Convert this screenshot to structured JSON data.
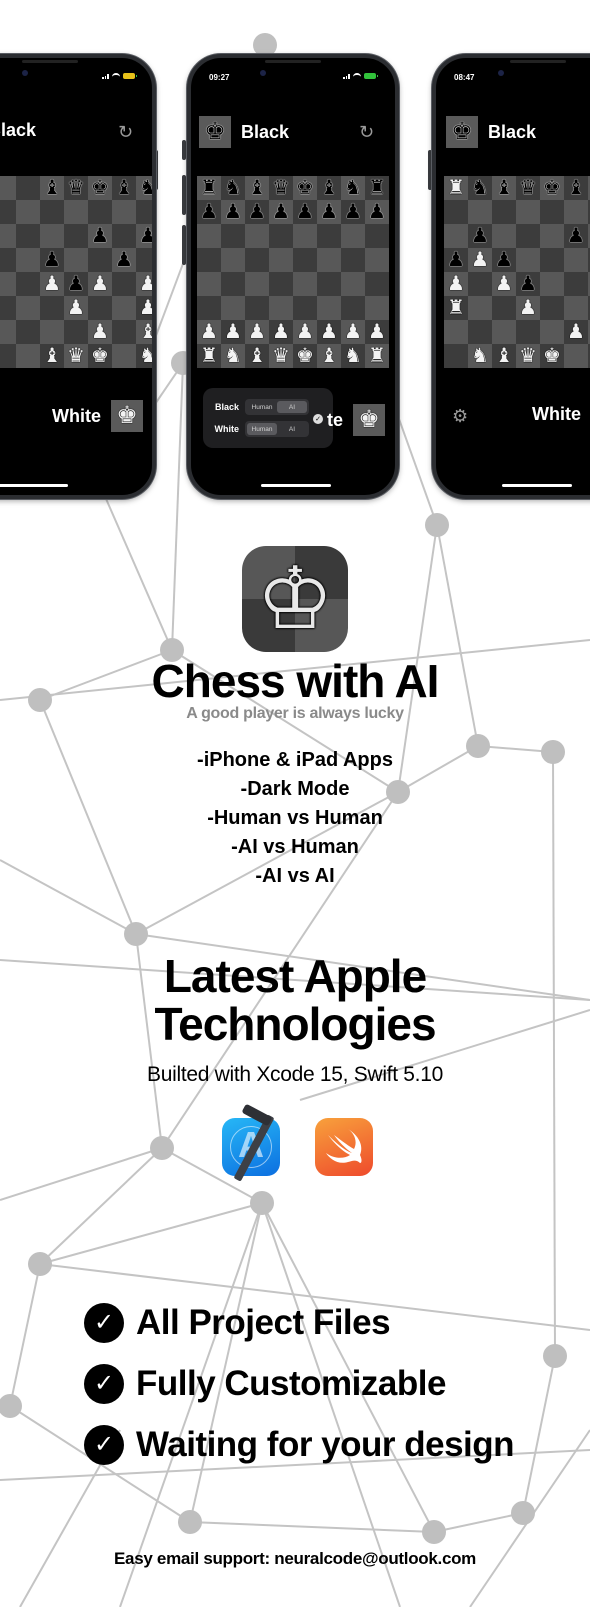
{
  "colors": {
    "background": "#ffffff",
    "network_line": "#c4c4c4",
    "network_node": "#bfbfbf",
    "phone_bezel": "#2b2d31",
    "board_light": "#585858",
    "board_dark": "#3c3c3c",
    "subtitle_gray": "#8a8a8a",
    "battery_green": "#32c23b"
  },
  "phones": [
    {
      "time": "",
      "top_player": "Black",
      "bottom_player": "White",
      "refresh_icon": "refresh-icon",
      "board": [
        "♝♛♚♝♞♜",
        "      ",
        "  p p ",
        "p  p p",
        "PpP P P",
        " P  P ",
        "  P B ",
        "BQK NR"
      ]
    },
    {
      "time": "09:27",
      "top_player": "Black",
      "bottom_player_partial": "te",
      "refresh_icon": "refresh-icon",
      "mode_panel": {
        "rows": [
          {
            "label": "Black",
            "options": [
              "Human",
              "AI"
            ],
            "selected": "AI"
          },
          {
            "label": "White",
            "options": [
              "Human",
              "AI"
            ],
            "selected": "Human"
          }
        ]
      }
    },
    {
      "time": "08:47",
      "top_player": "Black",
      "bottom_player": "White",
      "settings_icon": "gear-icon"
    }
  ],
  "promo": {
    "app_icon": "white-king-icon",
    "title": "Chess with AI",
    "tagline": "A good player is always lucky",
    "features": [
      "-iPhone & iPad  Apps",
      "-Dark Mode",
      "-Human vs Human",
      "-AI vs Human",
      "-AI vs AI"
    ],
    "tech_heading_line1": "Latest Apple",
    "tech_heading_line2": "Technologies",
    "built_with": "Builted with Xcode 15, Swift 5.10",
    "tech_icons": [
      "xcode-icon",
      "swift-icon"
    ],
    "checklist": [
      "All Project Files",
      "Fully Customizable",
      "Waiting for your design"
    ],
    "support": "Easy email support: neuralcode@outlook.com"
  }
}
